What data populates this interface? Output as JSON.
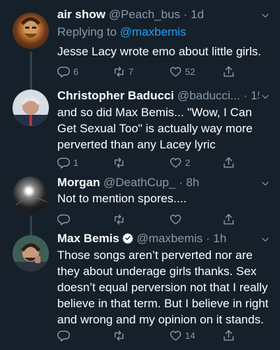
{
  "tweets": [
    {
      "name": "air show",
      "handle": "@Peach_bus",
      "time": "· 1d",
      "replying_prefix": "Replying to",
      "replying_handle": "@maxbemis",
      "text": "Jesse Lacy wrote emo about little girls.",
      "replies": "6",
      "retweets": "7",
      "likes": "52"
    },
    {
      "name": "Christopher Baducci",
      "handle": "@baducci...",
      "time": "· 15h",
      "text": "and so did Max Bemis... \"Wow, I Can Get Sexual Too\" is actually way more perverted than any Lacey lyric",
      "replies": "1",
      "retweets": "",
      "likes": "2"
    },
    {
      "name": "Morgan",
      "handle": "@DeathCup_",
      "time": "· 8h",
      "text": "Not to mention spores....",
      "replies": "",
      "retweets": "",
      "likes": ""
    },
    {
      "name": "Max Bemis",
      "handle": "@maxbemis",
      "time": "· 1h",
      "text": "Those songs aren’t perverted nor are they about underage girls thanks. Sex doesn’t equal perversion not that I really believe in that term. But I believe in right and wrong and my opinion on it stands.",
      "replies": "",
      "retweets": "",
      "likes": "14"
    }
  ],
  "colors": {
    "background": "#15202b",
    "muted": "#8899a6",
    "link": "#1da1f2",
    "divider": "#38444d"
  }
}
